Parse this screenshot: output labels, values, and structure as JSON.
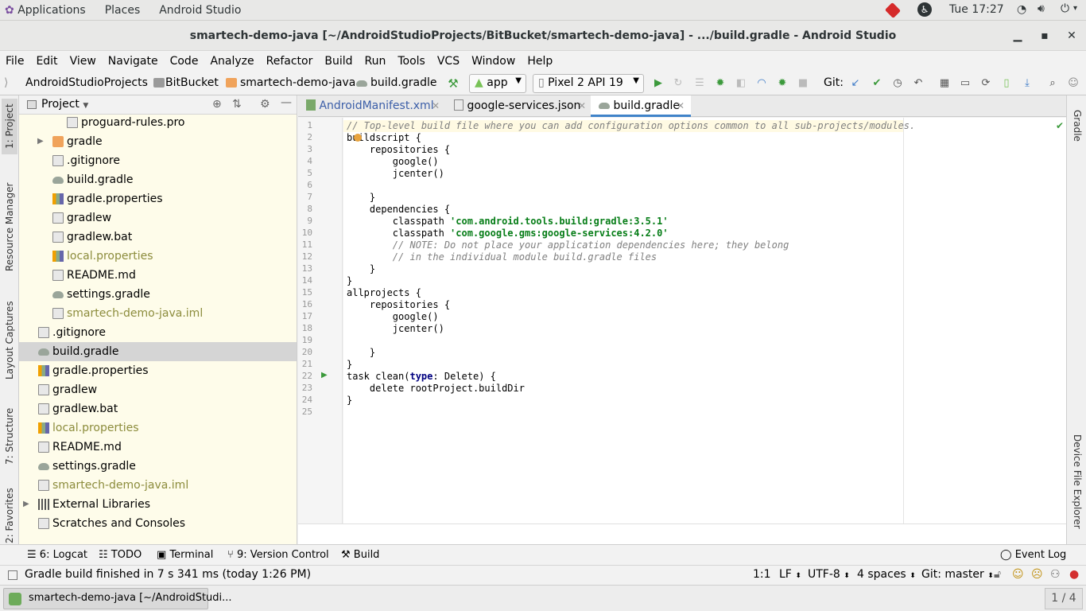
{
  "gnome": {
    "applications": "Applications",
    "places": "Places",
    "app": "Android Studio",
    "clock": "Tue 17:27"
  },
  "window": {
    "title": "smartech-demo-java [~/AndroidStudioProjects/BitBucket/smartech-demo-java] - .../build.gradle - Android Studio"
  },
  "menu": [
    "File",
    "Edit",
    "View",
    "Navigate",
    "Code",
    "Analyze",
    "Refactor",
    "Build",
    "Run",
    "Tools",
    "VCS",
    "Window",
    "Help"
  ],
  "breadcrumb": [
    "AndroidStudioProjects",
    "BitBucket",
    "smartech-demo-java",
    "build.gradle"
  ],
  "toolbar": {
    "module": "app",
    "device": "Pixel 2 API 19",
    "git_label": "Git:"
  },
  "left_tabs": [
    "1: Project",
    "Resource Manager",
    "Layout Captures",
    "7: Structure",
    "2: Favorites"
  ],
  "project_panel": {
    "title": "Project",
    "items": [
      {
        "label": "proguard-rules.pro"
      },
      {
        "label": "gradle"
      },
      {
        "label": ".gitignore"
      },
      {
        "label": "build.gradle"
      },
      {
        "label": "gradle.properties"
      },
      {
        "label": "gradlew"
      },
      {
        "label": "gradlew.bat"
      },
      {
        "label": "local.properties"
      },
      {
        "label": "README.md"
      },
      {
        "label": "settings.gradle"
      },
      {
        "label": "smartech-demo-java.iml"
      },
      {
        "label": ".gitignore"
      },
      {
        "label": "build.gradle"
      },
      {
        "label": "gradle.properties"
      },
      {
        "label": "gradlew"
      },
      {
        "label": "gradlew.bat"
      },
      {
        "label": "local.properties"
      },
      {
        "label": "README.md"
      },
      {
        "label": "settings.gradle"
      },
      {
        "label": "smartech-demo-java.iml"
      },
      {
        "label": "External Libraries"
      },
      {
        "label": "Scratches and Consoles"
      }
    ]
  },
  "editor_tabs": [
    "AndroidManifest.xml",
    "google-services.json",
    "build.gradle"
  ],
  "code_lines": [
    {
      "n": "1",
      "t": "// Top-level build file where you can add configuration options common to all sub-projects/modules."
    },
    {
      "n": "2",
      "t": "buildscript {"
    },
    {
      "n": "3",
      "t": "    repositories {"
    },
    {
      "n": "4",
      "t": "        google()"
    },
    {
      "n": "5",
      "t": "        jcenter()"
    },
    {
      "n": "6",
      "t": ""
    },
    {
      "n": "7",
      "t": "    }"
    },
    {
      "n": "8",
      "t": "    dependencies {"
    },
    {
      "n": "9",
      "t": "        classpath 'com.android.tools.build:gradle:3.5.1'"
    },
    {
      "n": "10",
      "t": "        classpath 'com.google.gms:google-services:4.2.0'"
    },
    {
      "n": "11",
      "t": "        // NOTE: Do not place your application dependencies here; they belong"
    },
    {
      "n": "12",
      "t": "        // in the individual module build.gradle files"
    },
    {
      "n": "13",
      "t": "    }"
    },
    {
      "n": "14",
      "t": "}"
    },
    {
      "n": "15",
      "t": "allprojects {"
    },
    {
      "n": "16",
      "t": "    repositories {"
    },
    {
      "n": "17",
      "t": "        google()"
    },
    {
      "n": "18",
      "t": "        jcenter()"
    },
    {
      "n": "19",
      "t": ""
    },
    {
      "n": "20",
      "t": "    }"
    },
    {
      "n": "21",
      "t": "}"
    },
    {
      "n": "22",
      "t": "task clean(type: Delete) {"
    },
    {
      "n": "23",
      "t": "    delete rootProject.buildDir"
    },
    {
      "n": "24",
      "t": "}"
    },
    {
      "n": "25",
      "t": ""
    }
  ],
  "right_tabs": [
    "Gradle",
    "Device File Explorer"
  ],
  "bottom_tabs": [
    "6: Logcat",
    "TODO",
    "Terminal",
    "9: Version Control",
    "Build",
    "Event Log"
  ],
  "status": {
    "message": "Gradle build finished in 7 s 341 ms (today 1:26 PM)",
    "position": "1:1",
    "line_sep": "LF",
    "encoding": "UTF-8",
    "indent": "4 spaces",
    "git": "Git: master"
  },
  "taskbar": {
    "item": "smartech-demo-java [~/AndroidStudi...",
    "pager": "1 / 4"
  }
}
